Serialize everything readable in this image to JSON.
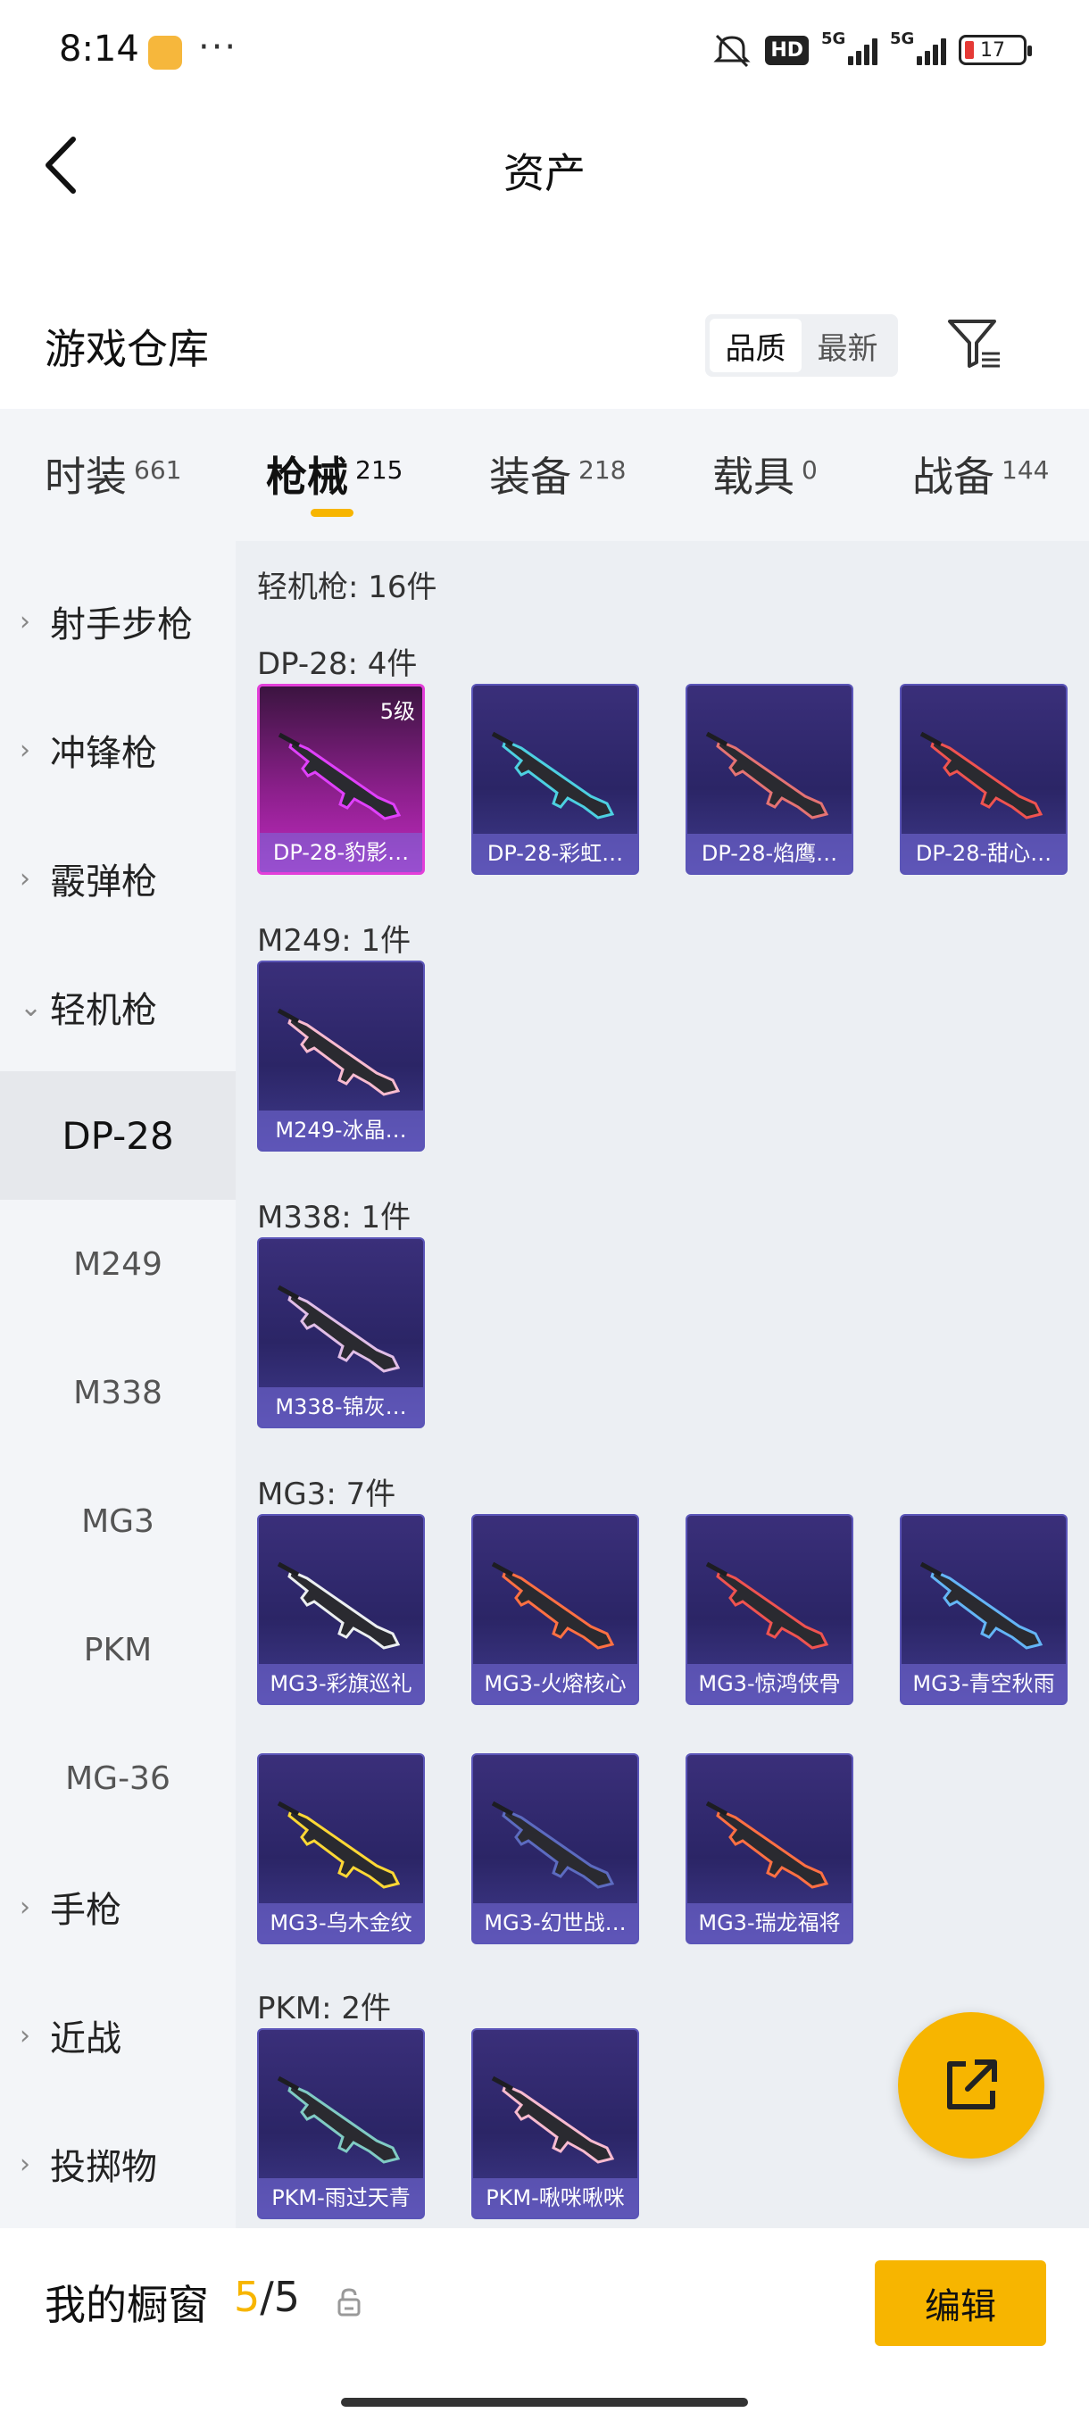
{
  "status": {
    "time": "8:14",
    "dots": "···",
    "hd": "HD",
    "net1": "5G",
    "net2": "5G",
    "battery": "17"
  },
  "header": {
    "title": "资产"
  },
  "warehouse": {
    "title": "游戏仓库",
    "sort_options": [
      "品质",
      "最新"
    ],
    "sort_selected": "品质"
  },
  "tabs": [
    {
      "label": "时装",
      "count": "661"
    },
    {
      "label": "枪械",
      "count": "215"
    },
    {
      "label": "装备",
      "count": "218"
    },
    {
      "label": "载具",
      "count": "0"
    },
    {
      "label": "战备",
      "count": "144"
    }
  ],
  "sidebar": {
    "items": [
      {
        "label": "射手步枪"
      },
      {
        "label": "冲锋枪"
      },
      {
        "label": "霰弹枪"
      },
      {
        "label": "轻机枪"
      },
      {
        "label": "DP-28"
      },
      {
        "label": "M249"
      },
      {
        "label": "M338"
      },
      {
        "label": "MG3"
      },
      {
        "label": "PKM"
      },
      {
        "label": "MG-36"
      },
      {
        "label": "手枪"
      },
      {
        "label": "近战"
      },
      {
        "label": "投掷物"
      }
    ]
  },
  "content": {
    "summary": "轻机枪: 16件",
    "sections": [
      {
        "label": "DP-28: 4件",
        "items": [
          {
            "name": "DP-28-豹影…",
            "level": "5级",
            "accent": "#e040fb"
          },
          {
            "name": "DP-28-彩虹…",
            "accent": "#4dd0e1"
          },
          {
            "name": "DP-28-焰鹰…",
            "accent": "#e57373"
          },
          {
            "name": "DP-28-甜心…",
            "accent": "#ef5350"
          }
        ]
      },
      {
        "label": "M249: 1件",
        "items": [
          {
            "name": "M249-冰晶…",
            "accent": "#f8bbd0"
          }
        ]
      },
      {
        "label": "M338: 1件",
        "items": [
          {
            "name": "M338-锦灰…",
            "accent": "#e1bee7"
          }
        ]
      },
      {
        "label": "MG3: 7件",
        "items": [
          {
            "name": "MG3-彩旗巡礼",
            "accent": "#eceff1"
          },
          {
            "name": "MG3-火熔核心",
            "accent": "#ff7043"
          },
          {
            "name": "MG3-惊鸿侠骨",
            "accent": "#ef5350"
          },
          {
            "name": "MG3-青空秋雨",
            "accent": "#64b5f6"
          },
          {
            "name": "MG3-乌木金纹",
            "accent": "#fdd835"
          },
          {
            "name": "MG3-幻世战…",
            "accent": "#5c6bc0"
          },
          {
            "name": "MG3-瑞龙福将",
            "accent": "#ff7043"
          }
        ]
      },
      {
        "label": "PKM: 2件",
        "items": [
          {
            "name": "PKM-雨过天青",
            "accent": "#80cbc4"
          },
          {
            "name": "PKM-啾咪啾咪",
            "accent": "#f8bbd0"
          }
        ]
      }
    ]
  },
  "bottom": {
    "label": "我的橱窗",
    "current": "5",
    "sep": "/",
    "total": "5",
    "edit": "编辑"
  }
}
